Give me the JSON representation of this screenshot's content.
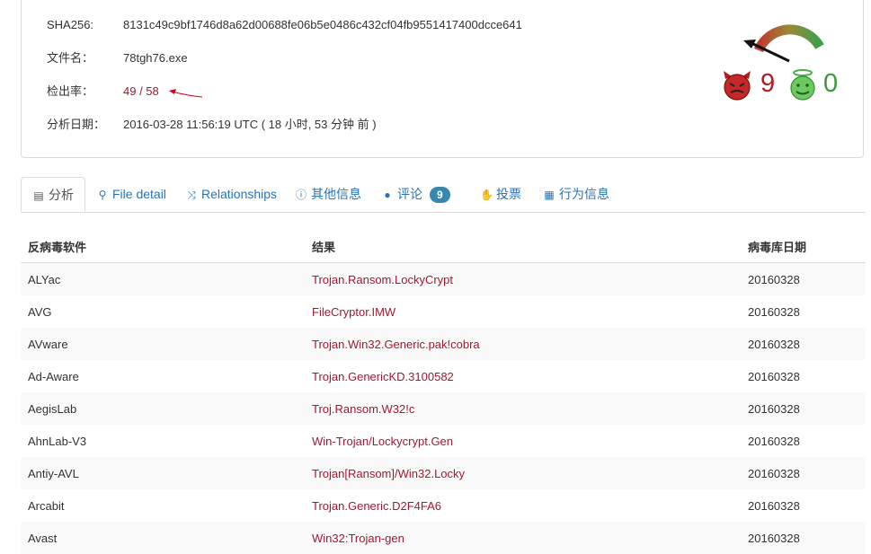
{
  "file_info": {
    "sha256_label": "SHA256:",
    "sha256_value": "8131c49c9bf1746d8a62d00688fe06b5e0486c432cf04fb9551417400dcce641",
    "filename_label": "文件名：",
    "filename_value": "78tgh76.exe",
    "detection_label": "检出率：",
    "detection_value": "49 / 58",
    "date_label": "分析日期：",
    "date_value": "2016-03-28 11:56:19 UTC ( 18 小时, 53 分钟 前 )"
  },
  "votes": {
    "malicious": "9",
    "harmless": "0",
    "gauge_fraction_malicious": 0.85
  },
  "colors": {
    "accent": "#2a74b4",
    "detection_red": "#a0192e",
    "malicious": "#b01e1e",
    "harmless": "#3a9a3a",
    "badge": "#3a87ad"
  },
  "tabs": [
    {
      "label": "分析",
      "icon": "table-icon"
    },
    {
      "label": "File detail",
      "icon": "search-icon"
    },
    {
      "label": "Relationships",
      "icon": "shuffle-icon"
    },
    {
      "label": "其他信息",
      "icon": "info-icon"
    },
    {
      "label": "评论",
      "icon": "comment-icon",
      "badge": "9"
    },
    {
      "label": "投票",
      "icon": "thumbs-down-icon"
    },
    {
      "label": "行为信息",
      "icon": "film-icon"
    }
  ],
  "table": {
    "headers": [
      "反病毒软件",
      "结果",
      "病毒库日期"
    ],
    "rows": [
      {
        "engine": "ALYac",
        "result": "Trojan.Ransom.LockyCrypt",
        "date": "20160328"
      },
      {
        "engine": "AVG",
        "result": "FileCryptor.IMW",
        "date": "20160328"
      },
      {
        "engine": "AVware",
        "result": "Trojan.Win32.Generic.pak!cobra",
        "date": "20160328"
      },
      {
        "engine": "Ad-Aware",
        "result": "Trojan.GenericKD.3100582",
        "date": "20160328"
      },
      {
        "engine": "AegisLab",
        "result": "Troj.Ransom.W32!c",
        "date": "20160328"
      },
      {
        "engine": "AhnLab-V3",
        "result": "Win-Trojan/Lockycrypt.Gen",
        "date": "20160328"
      },
      {
        "engine": "Antiy-AVL",
        "result": "Trojan[Ransom]/Win32.Locky",
        "date": "20160328"
      },
      {
        "engine": "Arcabit",
        "result": "Trojan.Generic.D2F4FA6",
        "date": "20160328"
      },
      {
        "engine": "Avast",
        "result": "Win32:Trojan-gen",
        "date": "20160328"
      }
    ]
  }
}
